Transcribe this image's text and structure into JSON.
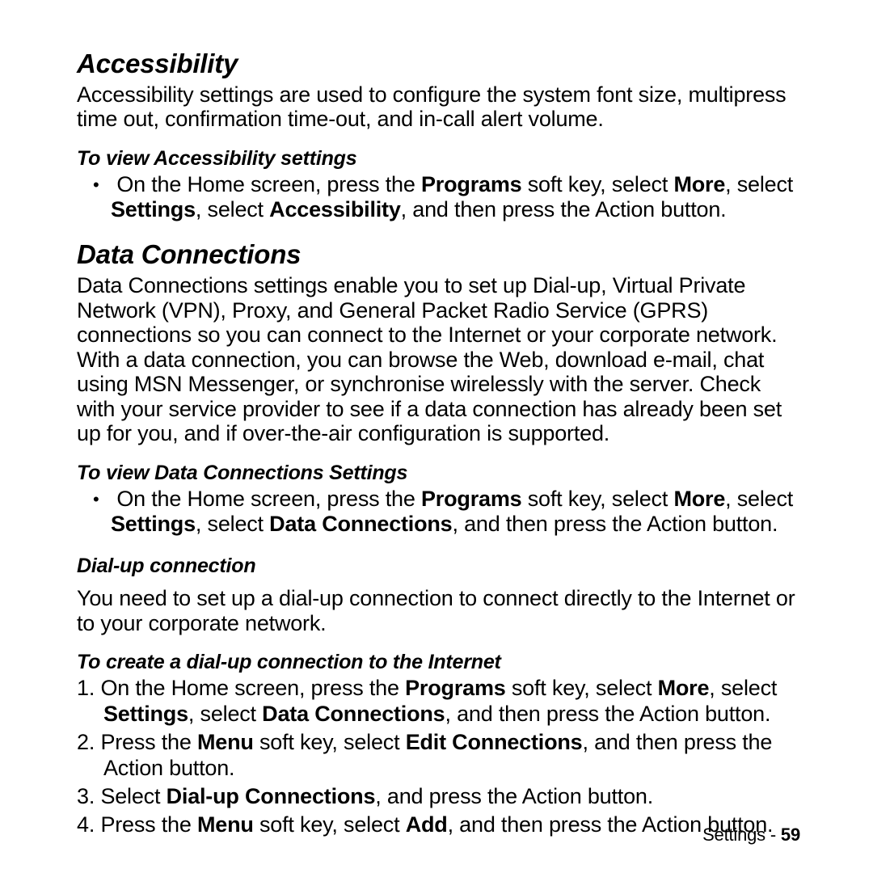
{
  "sections": {
    "accessibility": {
      "title": "Accessibility",
      "intro": "Accessibility settings are used to configure the system font size, multipress time out, confirmation time-out, and in-call alert volume.",
      "view_heading": "To view Accessibility settings",
      "view_bullet": {
        "t1": "On the Home screen, press the ",
        "b1": "Programs",
        "t2": " soft key, select ",
        "b2": "More",
        "t3": ", select ",
        "b3": "Settings",
        "t4": ", select ",
        "b4": "Accessibility",
        "t5": ", and then press the Action button."
      }
    },
    "data_connections": {
      "title": "Data Connections",
      "intro": "Data Connections settings enable you to set up Dial-up, Virtual Private Network (VPN), Proxy, and General Packet Radio Service (GPRS) connections so you can connect to the Internet or your corporate network. With a data connection, you can browse the Web, download e-mail, chat using MSN Messenger, or synchronise wirelessly with the server. Check with your service provider to see if a data connection has already been set up for you, and if over-the-air configuration is supported.",
      "view_heading": "To view Data Connections Settings",
      "view_bullet": {
        "t1": "On the Home screen, press the ",
        "b1": "Programs",
        "t2": " soft key, select ",
        "b2": "More",
        "t3": ", select ",
        "b3": "Settings",
        "t4": ", select ",
        "b4": "Data Connections",
        "t5": ", and then press the Action button."
      },
      "dialup_heading": "Dial-up connection",
      "dialup_intro": "You need to set up a dial-up connection to connect directly to the Internet or to your corporate network.",
      "create_heading": "To create a dial-up connection to the Internet",
      "steps": {
        "s1": {
          "t1": "On the Home screen, press the ",
          "b1": "Programs",
          "t2": " soft key, select ",
          "b2": "More",
          "t3": ", select ",
          "b3": "Settings",
          "t4": ", select ",
          "b4": "Data Connections",
          "t5": ", and then press the Action button."
        },
        "s2": {
          "t1": "Press the ",
          "b1": "Menu",
          "t2": " soft key, select ",
          "b2": "Edit Connections",
          "t3": ", and then press the Action button."
        },
        "s3": {
          "t1": "Select ",
          "b1": "Dial-up Connections",
          "t2": ", and press the Action button."
        },
        "s4": {
          "t1": "Press the ",
          "b1": "Menu",
          "t2": " soft key, select ",
          "b2": "Add",
          "t3": ", and then press the Action button."
        }
      }
    }
  },
  "footer": {
    "section": "Settings",
    "dash": " - ",
    "page": "59"
  }
}
